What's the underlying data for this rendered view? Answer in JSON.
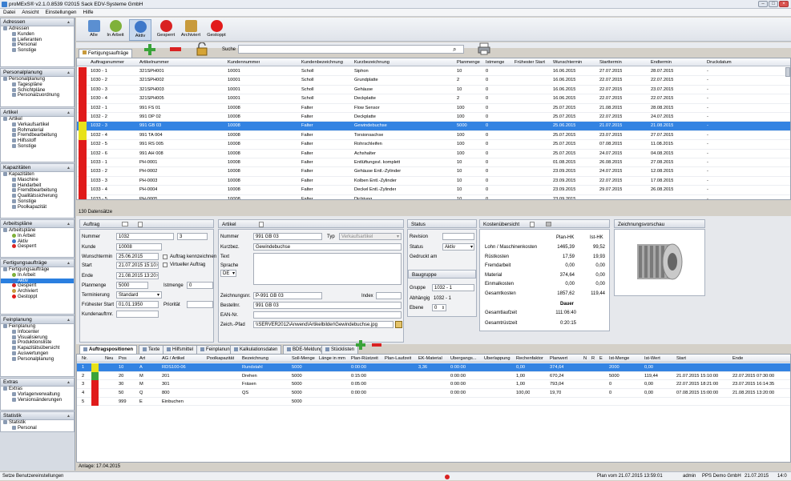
{
  "window": {
    "title": "proMExS® v2.1.0.8539 ©2015 Sack EDV-Systeme GmbH"
  },
  "menu": [
    "Datei",
    "Ansicht",
    "Einstellungen",
    "Hilfe"
  ],
  "sidebar": {
    "groups": [
      {
        "title": "Adressen",
        "items": [
          {
            "label": "Adressen",
            "level": 0,
            "icon": "address-book-icon"
          },
          {
            "label": "Kunden",
            "level": 1,
            "icon": "customer-icon"
          },
          {
            "label": "Lieferanten",
            "level": 1,
            "icon": "supplier-icon"
          },
          {
            "label": "Personal",
            "level": 1,
            "icon": "staff-icon"
          },
          {
            "label": "Sonstige",
            "level": 1,
            "icon": "other-icon"
          }
        ]
      },
      {
        "title": "Personalplanung",
        "items": [
          {
            "label": "Personalplanung",
            "level": 0,
            "icon": "staff-planning-icon"
          },
          {
            "label": "Tagespläne",
            "level": 1,
            "icon": "calendar-icon"
          },
          {
            "label": "Schichtpläne",
            "level": 1,
            "icon": "calendar-icon"
          },
          {
            "label": "Personalzuordnung",
            "level": 1,
            "icon": "staff-icon"
          }
        ]
      },
      {
        "title": "Artikel",
        "items": [
          {
            "label": "Artikel",
            "level": 0,
            "icon": "article-icon"
          },
          {
            "label": "Verkaufsartikel",
            "level": 1,
            "icon": "article-icon"
          },
          {
            "label": "Rohmaterial",
            "level": 1,
            "icon": "article-icon"
          },
          {
            "label": "Fremdbearbeitung",
            "level": 1,
            "icon": "article-icon"
          },
          {
            "label": "Hilfsstoff",
            "level": 1,
            "icon": "article-icon"
          },
          {
            "label": "Sonstige",
            "level": 1,
            "icon": "article-icon"
          }
        ]
      },
      {
        "title": "Kapazitäten",
        "items": [
          {
            "label": "Kapazitäten",
            "level": 0,
            "icon": "capacity-icon"
          },
          {
            "label": "Maschine",
            "level": 1,
            "icon": "machine-icon"
          },
          {
            "label": "Handarbeit",
            "level": 1,
            "icon": "hand-icon"
          },
          {
            "label": "Fremdbearbeitung",
            "level": 1,
            "icon": "machine-icon"
          },
          {
            "label": "Qualitätssicherung",
            "level": 1,
            "icon": "machine-icon"
          },
          {
            "label": "Sonstige",
            "level": 1,
            "icon": "machine-icon"
          },
          {
            "label": "Poolkapazität",
            "level": 1,
            "icon": "machine-icon"
          }
        ]
      },
      {
        "title": "Arbeitspläne",
        "items": [
          {
            "label": "Arbeitspläne",
            "level": 0,
            "icon": "workplan-icon"
          },
          {
            "label": "In Arbeit",
            "level": 1,
            "icon": "inwork-icon"
          },
          {
            "label": "Aktiv",
            "level": 1,
            "icon": "active-icon"
          },
          {
            "label": "Gesperrt",
            "level": 1,
            "icon": "locked-icon"
          }
        ]
      },
      {
        "title": "Fertigungsaufträge",
        "items": [
          {
            "label": "Fertigungsaufträge",
            "level": 0,
            "icon": "order-icon"
          },
          {
            "label": "In Arbeit",
            "level": 1,
            "icon": "inwork-icon"
          },
          {
            "label": "Aktiv",
            "level": 1,
            "icon": "active-icon",
            "selected": true
          },
          {
            "label": "Gesperrt",
            "level": 1,
            "icon": "locked-icon"
          },
          {
            "label": "Archiviert",
            "level": 1,
            "icon": "archive-icon"
          },
          {
            "label": "Gestoppt",
            "level": 1,
            "icon": "stopped-icon"
          }
        ]
      },
      {
        "title": "Feinplanung",
        "items": [
          {
            "label": "Feinplanung",
            "level": 0,
            "icon": "planning-icon"
          },
          {
            "label": "Infocenter",
            "level": 1,
            "icon": "info-icon"
          },
          {
            "label": "Visualisierung",
            "level": 1,
            "icon": "chart-icon"
          },
          {
            "label": "Produktionsliste",
            "level": 1,
            "icon": "list-icon"
          },
          {
            "label": "Kapazitätsübersicht",
            "level": 1,
            "icon": "capacity-icon"
          },
          {
            "label": "Auswertungen",
            "level": 1,
            "icon": "report-icon"
          },
          {
            "label": "Personalplanung",
            "level": 1,
            "icon": "staff-icon"
          }
        ]
      },
      {
        "title": "Extras",
        "items": [
          {
            "label": "Extras",
            "level": 0,
            "icon": "extras-icon"
          },
          {
            "label": "Vorlagenverwaltung",
            "level": 1,
            "icon": "template-icon"
          },
          {
            "label": "Versionsänderungen",
            "level": 1,
            "icon": "version-icon"
          }
        ]
      },
      {
        "title": "Statistik",
        "items": [
          {
            "label": "Statistik",
            "level": 0,
            "icon": "statistic-icon"
          },
          {
            "label": "Personal",
            "level": 1,
            "icon": "staff-icon"
          }
        ]
      }
    ]
  },
  "toolbar": {
    "buttons": [
      {
        "label": "Alle",
        "icon": "all-icon",
        "color": "#5b8fd1"
      },
      {
        "label": "In Arbeit",
        "icon": "inwork-icon",
        "color": "#7fb13a"
      },
      {
        "label": "Aktiv",
        "icon": "active-icon",
        "color": "#3d77c9",
        "active": true
      },
      {
        "label": "Gesperrt",
        "icon": "locked-icon",
        "color": "#d92222"
      },
      {
        "label": "Archiviert",
        "icon": "archive-icon",
        "color": "#c89a3c"
      },
      {
        "label": "Gestoppt",
        "icon": "stopped-icon",
        "color": "#e21b1b"
      }
    ]
  },
  "orders_tab": "Fertigungsaufträge",
  "search": {
    "label": "Suche",
    "value": ""
  },
  "grid": {
    "columns": [
      "Auftragsnummer",
      "Artikelnummer",
      "Kundennummer",
      "Kundenbezeichnung",
      "Kurzbezeichnung",
      "Planmenge",
      "Istmenge",
      "Frühester Start",
      "Wunschtermin",
      "Starttermin",
      "Endtermin",
      "Druckdatum"
    ],
    "rows": [
      {
        "status": "#e01b1b",
        "c": [
          "1030 - 1",
          "321SPH001",
          "10001",
          "Scholl",
          "Siphon",
          "10",
          "0",
          "",
          "16.06.2015",
          "27.07.2015",
          "28.07.2015",
          "-"
        ]
      },
      {
        "status": "#e01b1b",
        "c": [
          "1030 - 2",
          "321SPH002",
          "10001",
          "Scholl",
          "Grundplatte",
          "2",
          "0",
          "",
          "16.06.2015",
          "22.07.2015",
          "22.07.2015",
          "-"
        ]
      },
      {
        "status": "#e01b1b",
        "c": [
          "1030 - 3",
          "321SPH003",
          "10001",
          "Scholl",
          "Gehäuse",
          "10",
          "0",
          "",
          "16.06.2015",
          "22.07.2015",
          "23.07.2015",
          "-"
        ]
      },
      {
        "status": "#e01b1b",
        "c": [
          "1030 - 4",
          "321SPH005",
          "10001",
          "Scholl",
          "Deckplatte",
          "2",
          "0",
          "",
          "16.06.2015",
          "22.07.2015",
          "22.07.2015",
          "-"
        ]
      },
      {
        "status": "#e01b1b",
        "c": [
          "1032 - 1",
          "991 FS 01",
          "10008",
          "Falter",
          "Flow Sensor",
          "100",
          "0",
          "",
          "25.07.2015",
          "21.08.2015",
          "28.08.2015",
          "-"
        ]
      },
      {
        "status": "#e01b1b",
        "c": [
          "1032 - 2",
          "991 DP 02",
          "10008",
          "Falter",
          "Deckplatte",
          "100",
          "0",
          "",
          "25.07.2015",
          "22.07.2015",
          "24.07.2015",
          "-"
        ]
      },
      {
        "status": "#e8e21a",
        "c": [
          "1032 - 3",
          "991 GB 03",
          "10008",
          "Falter",
          "Gewindebuchse",
          "5000",
          "0",
          "",
          "25.06.2015",
          "21.07.2015",
          "21.08.2015",
          "-"
        ],
        "selected": true
      },
      {
        "status": "#e8e21a",
        "c": [
          "1032 - 4",
          "991 TA 004",
          "10008",
          "Falter",
          "Torsionsachse",
          "100",
          "0",
          "",
          "25.07.2015",
          "23.07.2015",
          "27.07.2015",
          "-"
        ]
      },
      {
        "status": "#e01b1b",
        "c": [
          "1032 - 5",
          "991 RS 005",
          "10008",
          "Falter",
          "Rohrschleifen",
          "100",
          "0",
          "",
          "25.07.2015",
          "07.08.2015",
          "11.08.2015",
          "-"
        ]
      },
      {
        "status": "#e01b1b",
        "c": [
          "1032 - 6",
          "991 AH 008",
          "10008",
          "Falter",
          "Achshalter",
          "100",
          "0",
          "",
          "25.07.2015",
          "24.07.2015",
          "04.08.2015",
          "-"
        ]
      },
      {
        "status": "#e01b1b",
        "c": [
          "1033 - 1",
          "PH-0001",
          "10008",
          "Falter",
          "Entlüftungsvl. komplett",
          "10",
          "0",
          "",
          "01.08.2015",
          "26.08.2015",
          "27.08.2015",
          "-"
        ]
      },
      {
        "status": "#e01b1b",
        "c": [
          "1033 - 2",
          "PH-0002",
          "10008",
          "Falter",
          "Gehäuse Entl.-Zylinder",
          "10",
          "0",
          "",
          "23.09.2015",
          "24.07.2015",
          "12.08.2015",
          "-"
        ]
      },
      {
        "status": "#e01b1b",
        "c": [
          "1033 - 3",
          "PH-0003",
          "10008",
          "Falter",
          "Kolben Entl.-Zylinder",
          "10",
          "0",
          "",
          "23.09.2015",
          "22.07.2015",
          "17.08.2015",
          "-"
        ]
      },
      {
        "status": "#e01b1b",
        "c": [
          "1033 - 4",
          "PH-0004",
          "10008",
          "Falter",
          "Deckel Entl.-Zylinder",
          "10",
          "0",
          "",
          "23.09.2015",
          "29.07.2015",
          "26.08.2015",
          "-"
        ]
      },
      {
        "status": "#e01b1b",
        "c": [
          "1033 - 5",
          "PH-0005",
          "10008",
          "Falter",
          "Dichtung",
          "10",
          "0",
          "",
          "23.09.2015",
          "",
          "",
          "-"
        ]
      }
    ]
  },
  "count_label": "130 Datensätze",
  "auftrag": {
    "title": "Auftrag",
    "nummer_label": "Nummer",
    "nummer": "1032",
    "nummer2": "3",
    "kunde_label": "Kunde",
    "kunde": "10008",
    "wunsch_label": "Wunschtermin",
    "wunsch": "25.06.2015",
    "kennz_label": "Auftrag kennzeichnen",
    "start_label": "Start",
    "start": "21.07.2015 15:10:00",
    "virt_label": "Virtueller Auftrag",
    "ende_label": "Ende",
    "ende": "21.08.2015 13:20:00",
    "planmenge_label": "Planmenge",
    "planmenge": "5000",
    "istmenge_label": "Istmenge",
    "istmenge": "0",
    "term_label": "Terminierung",
    "term": "Standard",
    "frueh_label": "Frühester Start",
    "frueh": "01.01.1950",
    "prio_label": "Priorität",
    "prio": "",
    "kundenauf_label": "Kundenauftrnr.",
    "kundenauf": ""
  },
  "artikel": {
    "title": "Artikel",
    "nummer_label": "Nummer",
    "nummer": "991 GB 03",
    "typ_label": "Typ",
    "typ": "Verkaufsartikel",
    "kurz_label": "Kurzbez.",
    "kurz": "Gewindebuchse",
    "text_label": "Text",
    "sprache_label": "Sprache",
    "sprache": "DE",
    "zeich_label": "Zeichnungsnr.",
    "zeich": "P-991 GB 03",
    "index_label": "Index",
    "bestell_label": "Bestellnr.",
    "bestell": "991 GB 03",
    "ean_label": "EAN-Nr.",
    "pfad_label": "Zeich.-Pfad",
    "pfad": "\\\\SERVER2012\\Anwend\\Artikelbilder\\Gewindebuchse.jpg"
  },
  "status": {
    "title": "Status",
    "revision_label": "Revision",
    "status_label": "Status",
    "status": "Aktiv",
    "gedruckt_label": "Gedruckt am",
    "baugruppe_label": "Baugruppe",
    "gruppe_label": "Gruppe",
    "gruppe": "1032 - 1",
    "abh_label": "Abhängig",
    "abh": "1032 - 1",
    "ebene_label": "Ebene",
    "ebene": "0"
  },
  "kosten": {
    "title": "Kostenübersicht",
    "col1": "Plan-HK",
    "col2": "Ist-HK",
    "rows": [
      [
        "Lohn / Maschinenkosten",
        "1465,39",
        "99,52"
      ],
      [
        "Rüstkosten",
        "17,59",
        "19,93"
      ],
      [
        "Fremdarbeit",
        "0,00",
        "0,00"
      ],
      [
        "Material",
        "374,64",
        "0,00"
      ],
      [
        "Einmalkosten",
        "0,00",
        "0,00"
      ],
      [
        "Gesamtkosten",
        "1857,62",
        "119,44"
      ]
    ],
    "dauer_label": "Dauer",
    "gl_label": "Gesamtlaufzeit",
    "gl": "111:06:40",
    "gr_label": "Gesamtrüstzeit",
    "gr": "0:20:15"
  },
  "vorschau": {
    "title": "Zeichnungsvorschau"
  },
  "bottom_tabs": [
    "Auftragspositionen",
    "Texte",
    "Hilfsmittel",
    "Feinplanung",
    "Kalkulationsdaten",
    "BDE-Meldungen",
    "Stücklisten"
  ],
  "ops": {
    "columns": [
      "Nr.",
      "Neu",
      "Pos",
      "Art",
      "AG / Artikel",
      "Poolkapazität",
      "Bezeichnung",
      "Soll-Menge",
      "Länge in mm",
      "Plan-Rüstzeit",
      "Plan-Laufzeit",
      "EK-Material",
      "Übergangs...",
      "Überlappung",
      "Rechenfaktor",
      "Planwert",
      "N",
      "R",
      "E",
      "Ist-Menge",
      "Ist-Wert",
      "Start",
      "Ende"
    ],
    "rows": [
      {
        "flag": "#e8e21a",
        "c": [
          "1",
          "",
          "10",
          "A",
          "RDS100-06",
          "",
          "Rundstahl",
          "5000",
          "",
          "0:00:00",
          "",
          "3,36",
          "0:00:00",
          "",
          "0,00",
          "374,64",
          "",
          "",
          "",
          "2000",
          "0,00",
          "",
          ""
        ],
        "selected": true
      },
      {
        "flag": "#3aa33a",
        "c": [
          "2",
          "",
          "20",
          "M",
          "201",
          "",
          "Drehen",
          "5000",
          "",
          "0:15:00",
          "",
          "",
          "0:00:00",
          "",
          "1,00",
          "670,24",
          "",
          "",
          "",
          "5000",
          "119,44",
          "21.07.2015 15:10:00",
          "22.07.2015 07:30:00"
        ]
      },
      {
        "flag": "#e01b1b",
        "c": [
          "3",
          "",
          "30",
          "M",
          "301",
          "",
          "Fräsen",
          "5000",
          "",
          "0:05:00",
          "",
          "",
          "0:00:00",
          "",
          "1,00",
          "793,04",
          "",
          "",
          "",
          "0",
          "0,00",
          "22.07.2015 18:21:00",
          "23.07.2015 16:14:35"
        ]
      },
      {
        "flag": "#e01b1b",
        "c": [
          "4",
          "",
          "50",
          "Q",
          "800",
          "",
          "QS",
          "5000",
          "",
          "0:00:00",
          "",
          "",
          "0:00:00",
          "",
          "100,00",
          "19,70",
          "",
          "",
          "",
          "0",
          "0,00",
          "07.08.2015 15:00:00",
          "21.08.2015 13:20:00"
        ]
      },
      {
        "flag": "#e01b1b",
        "c": [
          "5",
          "",
          "999",
          "E",
          "Einbuchen",
          "",
          "",
          "5000",
          "",
          "",
          "",
          "",
          "",
          "",
          "",
          "",
          "",
          "",
          "",
          "",
          "",
          "",
          ""
        ]
      }
    ]
  },
  "anlage": "Anlage: 17.04.2015",
  "statusbar": {
    "left": "Setze Benutzereinstellungen",
    "plan": "Plan vom 21.07.2015 13:59:01",
    "user": "admin",
    "company": "PPS Demo GmbH",
    "date": "21.07.2015",
    "time": "14:0"
  }
}
